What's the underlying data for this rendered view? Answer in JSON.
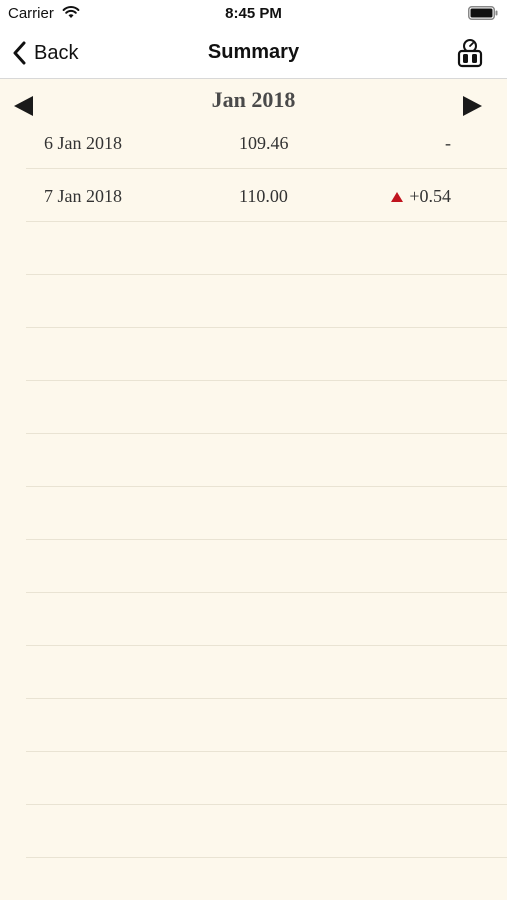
{
  "status_bar": {
    "carrier": "Carrier",
    "time": "8:45 PM"
  },
  "nav": {
    "back_label": "Back",
    "title": "Summary",
    "right_icon": "gauge-icon"
  },
  "month": {
    "title": "Jan 2018",
    "prev_icon": "left-triangle-icon",
    "next_icon": "right-triangle-icon"
  },
  "rows": [
    {
      "date": "6 Jan 2018",
      "value": "109.46",
      "change": "-",
      "trend": "none"
    },
    {
      "date": "7 Jan 2018",
      "value": "110.00",
      "change": "+0.54",
      "trend": "up"
    },
    {
      "date": "",
      "value": "",
      "change": "",
      "trend": "none"
    },
    {
      "date": "",
      "value": "",
      "change": "",
      "trend": "none"
    },
    {
      "date": "",
      "value": "",
      "change": "",
      "trend": "none"
    },
    {
      "date": "",
      "value": "",
      "change": "",
      "trend": "none"
    },
    {
      "date": "",
      "value": "",
      "change": "",
      "trend": "none"
    },
    {
      "date": "",
      "value": "",
      "change": "",
      "trend": "none"
    },
    {
      "date": "",
      "value": "",
      "change": "",
      "trend": "none"
    },
    {
      "date": "",
      "value": "",
      "change": "",
      "trend": "none"
    },
    {
      "date": "",
      "value": "",
      "change": "",
      "trend": "none"
    },
    {
      "date": "",
      "value": "",
      "change": "",
      "trend": "none"
    },
    {
      "date": "",
      "value": "",
      "change": "",
      "trend": "none"
    },
    {
      "date": "",
      "value": "",
      "change": "",
      "trend": "none"
    }
  ],
  "colors": {
    "background": "#fdf8ec",
    "up_arrow": "#c0141e",
    "row_divider": "#e9e3d3"
  }
}
